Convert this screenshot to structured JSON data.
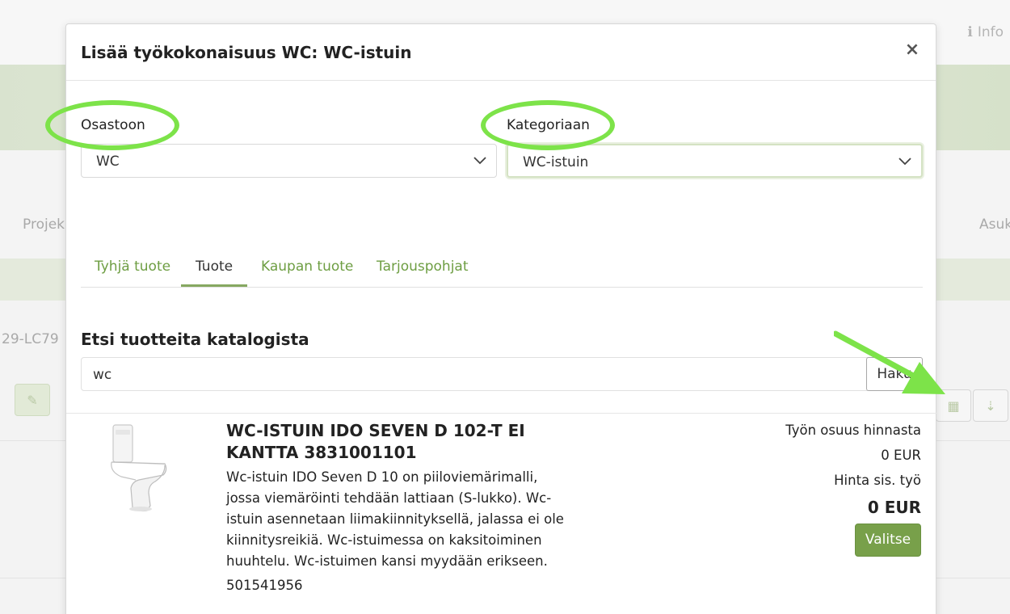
{
  "background": {
    "info_label": "Info",
    "nav_left_label": "Projek",
    "nav_right_label": "Asuk",
    "code_fragment": "29-LC79"
  },
  "modal": {
    "title": "Lisää työkokonaisuus WC: WC-istuin",
    "close_symbol": "×"
  },
  "fields": {
    "department": {
      "label": "Osastoon",
      "value": "WC"
    },
    "category": {
      "label": "Kategoriaan",
      "value": "WC-istuin"
    }
  },
  "tabs": [
    {
      "label": "Tyhjä tuote",
      "active": false
    },
    {
      "label": "Tuote",
      "active": true
    },
    {
      "label": "Kaupan tuote",
      "active": false
    },
    {
      "label": "Tarjouspohjat",
      "active": false
    }
  ],
  "search": {
    "title": "Etsi tuotteita katalogista",
    "value": "wc",
    "button_label": "Haku"
  },
  "product": {
    "title": "WC-ISTUIN IDO SEVEN D 102-T EI KANTTA 3831001101",
    "description": "Wc-istuin IDO Seven D 10 on piiloviemärimalli, jossa viemäröinti tehdään lattiaan (S-lukko). Wc-istuin asennetaan liimakiinnityksellä, jalassa ei ole kiinnitysreikiä. Wc-istuimessa on kaksitoiminen huuhtelu. Wc-istuimen kansi myydään erikseen.",
    "code": "501541956",
    "labor_share_label": "Työn osuus hinnasta",
    "labor_share_value": "0 EUR",
    "price_incl_label": "Hinta sis. työ",
    "price_incl_value": "0 EUR",
    "select_button": "Valitse"
  },
  "colors": {
    "accent_green": "#78a04a",
    "annotation_green": "#7de349",
    "tab_green": "#6e9e43"
  }
}
